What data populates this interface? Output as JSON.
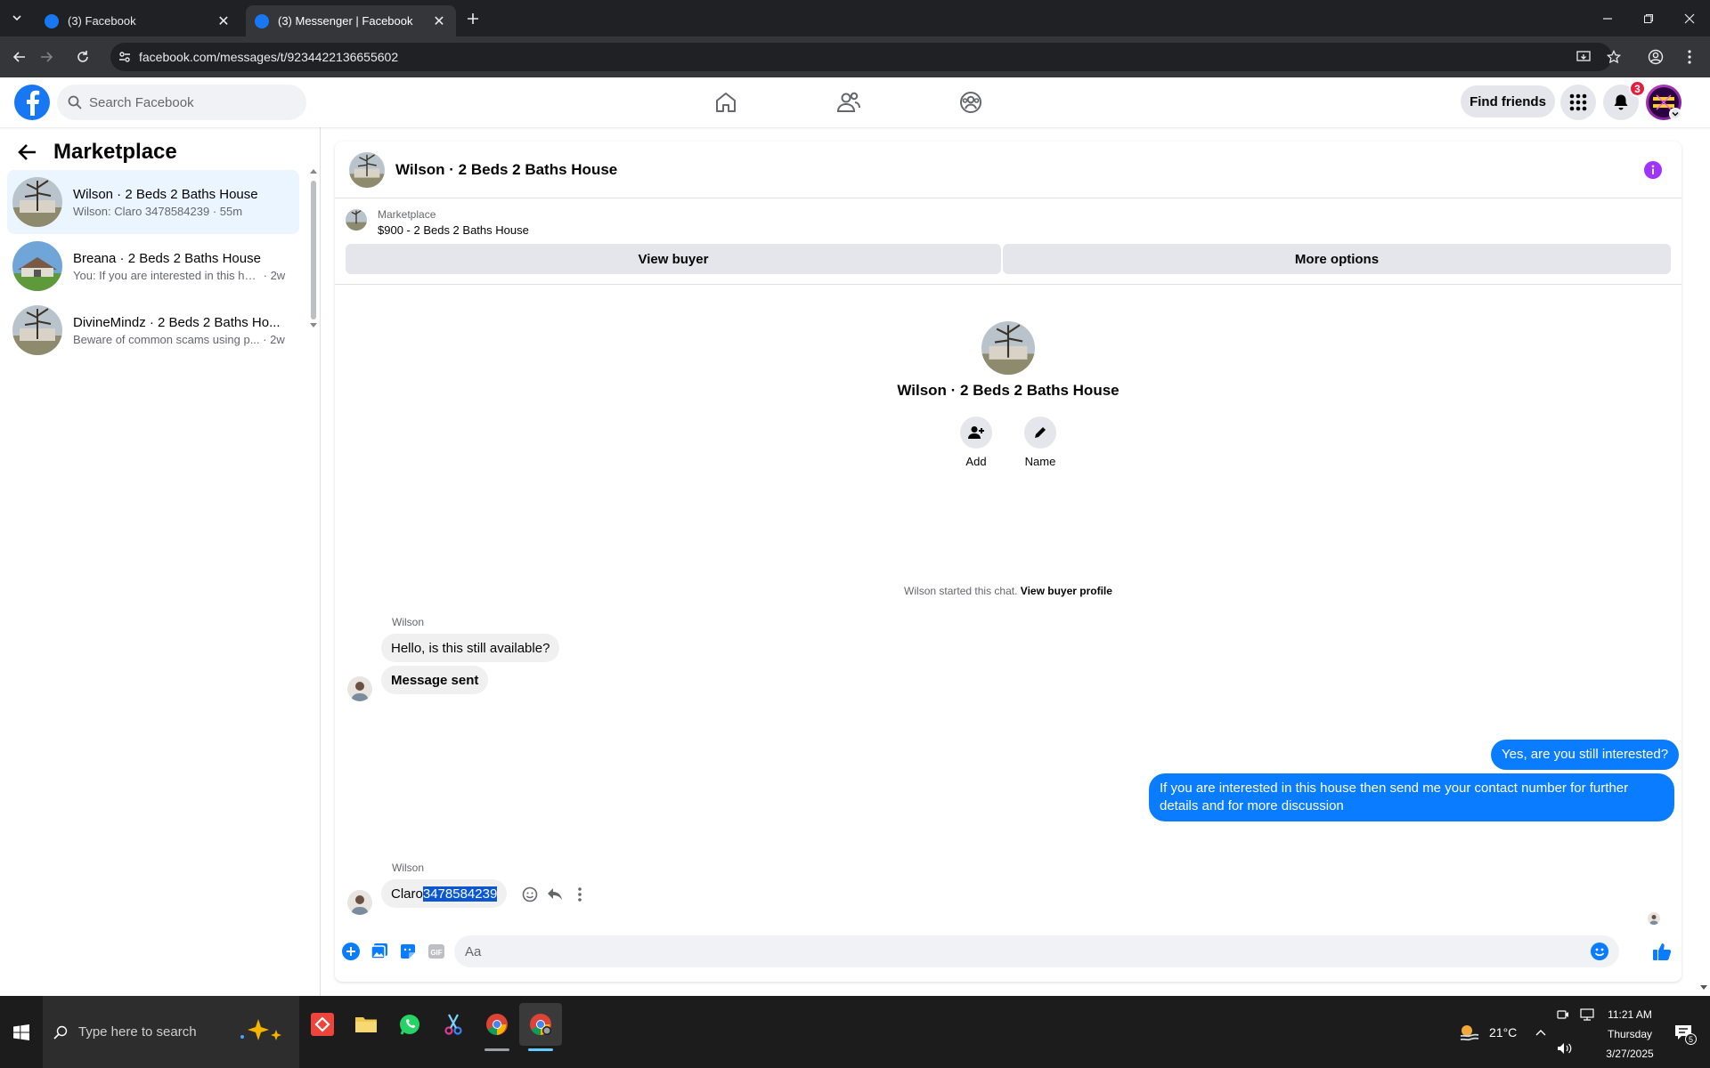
{
  "browser": {
    "tabs": [
      {
        "title": "(3) Facebook",
        "active": false
      },
      {
        "title": "(3) Messenger | Facebook",
        "active": true
      }
    ],
    "url": "facebook.com/messages/t/9234422136655602"
  },
  "fb": {
    "search_placeholder": "Search Facebook",
    "find_friends": "Find friends",
    "notification_count": "3",
    "brand_color": "#1877f2"
  },
  "sidebar": {
    "title": "Marketplace",
    "conversations": [
      {
        "name": "Wilson · 2 Beds 2 Baths House",
        "preview": "Wilson: Claro 3478584239",
        "time": "55m",
        "selected": true
      },
      {
        "name": "Breana · 2 Beds 2 Baths House",
        "preview": "You: If you are interested in this ho...",
        "time": "2w",
        "selected": false
      },
      {
        "name": "DivineMindz · 2 Beds 2 Baths Ho...",
        "preview": "Beware of common scams using p...",
        "time": "2w",
        "selected": false
      }
    ]
  },
  "chat": {
    "title": "Wilson · 2 Beds 2 Baths House",
    "marketplace_label": "Marketplace",
    "listing": "$900 - 2 Beds 2 Baths House",
    "view_buyer": "View buyer",
    "more_options": "More options",
    "intro_name": "Wilson · 2 Beds 2 Baths House",
    "add_label": "Add",
    "name_label": "Name",
    "started_text": "Wilson started this chat.",
    "view_profile": "View buyer profile",
    "messages": {
      "sender1": "Wilson",
      "in1": "Hello, is this still available?",
      "in2": "Message sent",
      "out1": "Yes, are you still interested?",
      "out2": "If you are interested in this house then send me your contact number for further details and for more discussion",
      "sender2": "Wilson",
      "in3_prefix": "Claro",
      "in3_selected": "3478584239"
    },
    "composer_placeholder": "Aa",
    "outgoing_color": "#0a7cff"
  },
  "taskbar": {
    "search_placeholder": "Type here to search",
    "temperature": "21°C",
    "time": "11:21 AM",
    "day": "Thursday",
    "date": "3/27/2025",
    "notif_count": "5"
  }
}
